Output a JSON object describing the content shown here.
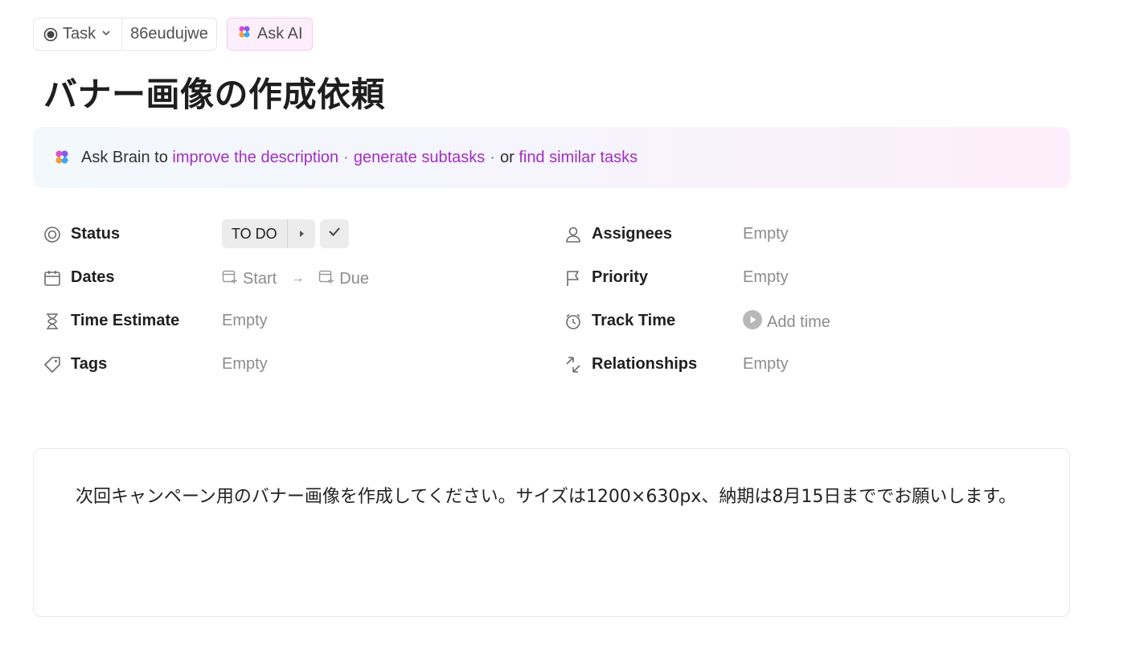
{
  "header": {
    "task_type_label": "Task",
    "task_id": "86eudujwe",
    "ask_ai_label": "Ask AI"
  },
  "title": "バナー画像の作成依頼",
  "brain": {
    "prefix": "Ask Brain to",
    "link1": "improve the description",
    "sep1": "·",
    "link2": "generate subtasks",
    "sep2": "·",
    "or": "or",
    "link3": "find similar tasks"
  },
  "properties": {
    "status": {
      "label": "Status",
      "value": "TO DO"
    },
    "dates": {
      "label": "Dates",
      "start": "Start",
      "arrow": "→",
      "due": "Due"
    },
    "time_estimate": {
      "label": "Time Estimate",
      "value": "Empty"
    },
    "tags": {
      "label": "Tags",
      "value": "Empty"
    },
    "assignees": {
      "label": "Assignees",
      "value": "Empty"
    },
    "priority": {
      "label": "Priority",
      "value": "Empty"
    },
    "track_time": {
      "label": "Track Time",
      "value": "Add time"
    },
    "relationships": {
      "label": "Relationships",
      "value": "Empty"
    }
  },
  "description": "次回キャンペーン用のバナー画像を作成してください。サイズは1200×630px、納期は8月15日まででお願いします。",
  "colors": {
    "accent_link": "#a12fc4",
    "muted": "#8c8c8c"
  }
}
